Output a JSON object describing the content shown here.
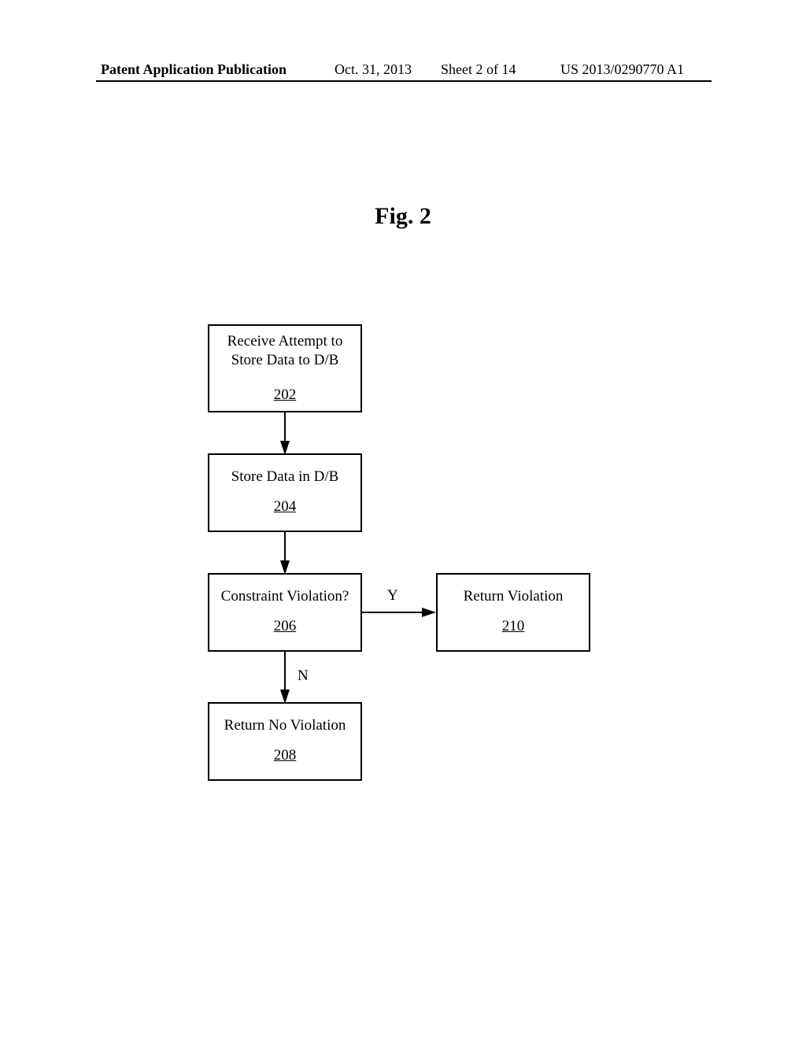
{
  "header": {
    "left": "Patent Application Publication",
    "date": "Oct. 31, 2013",
    "sheet": "Sheet 2 of 14",
    "pubno": "US 2013/0290770 A1"
  },
  "figure": {
    "title": "Fig. 2"
  },
  "boxes": {
    "b202": {
      "label": "Receive Attempt to\nStore Data to D/B",
      "ref": "202"
    },
    "b204": {
      "label": "Store Data in D/B",
      "ref": "204"
    },
    "b206": {
      "label": "Constraint Violation?",
      "ref": "206"
    },
    "b208": {
      "label": "Return No Violation",
      "ref": "208"
    },
    "b210": {
      "label": "Return Violation",
      "ref": "210"
    }
  },
  "edges": {
    "yes": "Y",
    "no": "N"
  }
}
